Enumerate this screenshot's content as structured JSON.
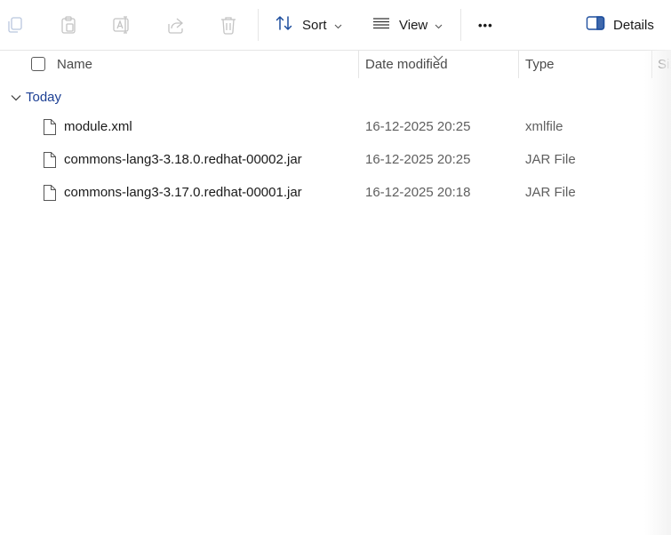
{
  "toolbar": {
    "icons": [
      "copy-icon",
      "paste-icon",
      "rename-icon",
      "share-icon",
      "delete-icon"
    ],
    "sort_label": "Sort",
    "view_label": "View",
    "more_label": "•••",
    "details_label": "Details"
  },
  "columns": {
    "name": "Name",
    "date_modified": "Date modified",
    "type": "Type",
    "size": "Siz"
  },
  "group": {
    "label": "Today"
  },
  "files": [
    {
      "name": "module.xml",
      "date": "16-12-2025 20:25",
      "type": "xmlfile"
    },
    {
      "name": "commons-lang3-3.18.0.redhat-00002.jar",
      "date": "16-12-2025 20:25",
      "type": "JAR File"
    },
    {
      "name": "commons-lang3-3.17.0.redhat-00001.jar",
      "date": "16-12-2025 20:18",
      "type": "JAR File"
    }
  ]
}
